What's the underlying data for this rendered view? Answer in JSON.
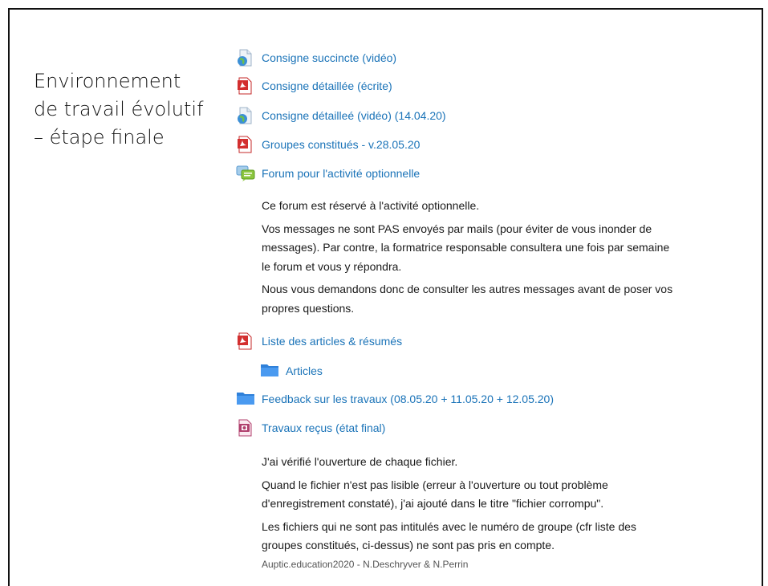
{
  "slide": {
    "title": "Environnement de travail évolutif – étape finale",
    "footer": "Auptic.education2020  -  N.Deschryver & N.Perrin"
  },
  "items": [
    {
      "label": "Consigne succincte (vidéo)",
      "icon": "globe-file-icon"
    },
    {
      "label": "Consigne détaillée (écrite)",
      "icon": "pdf-icon"
    },
    {
      "label": "Consigne détailleé (vidéo) (14.04.20)",
      "icon": "globe-file-icon"
    },
    {
      "label": "Groupes constitués - v.28.05.20",
      "icon": "pdf-icon"
    },
    {
      "label": "Forum pour l'activité optionnelle",
      "icon": "forum-icon"
    },
    {
      "label": "Liste des articles & résumés",
      "icon": "pdf-icon"
    },
    {
      "label": "Articles",
      "icon": "folder-icon"
    },
    {
      "label": "Feedback sur les travaux (08.05.20 + 11.05.20 + 12.05.20)",
      "icon": "folder-icon"
    },
    {
      "label": "Travaux reçus (état final)",
      "icon": "assignment-icon"
    }
  ],
  "forum_description": [
    "Ce forum est réservé à l'activité optionnelle.",
    "Vos messages ne sont PAS envoyés par mails (pour éviter de vous inonder de messages). Par contre, la formatrice responsable consultera une fois par semaine le forum et vous y répondra.",
    "Nous vous demandons donc de consulter les autres messages avant de poser vos propres questions."
  ],
  "travaux_description": [
    "J'ai vérifié l'ouverture de chaque fichier.",
    "Quand le fichier n'est pas lisible (erreur à l'ouverture ou tout problème d'enregistrement constaté), j'ai ajouté dans le titre \"fichier corrompu\".",
    "Les fichiers qui ne sont pas intitulés avec le numéro de groupe (cfr liste des groupes constitués, ci-dessus) ne sont pas pris en compte."
  ],
  "colors": {
    "link": "#1a73b8",
    "pdf": "#d32f2f",
    "folder": "#3a8ee6",
    "forum": "#7cc142"
  }
}
